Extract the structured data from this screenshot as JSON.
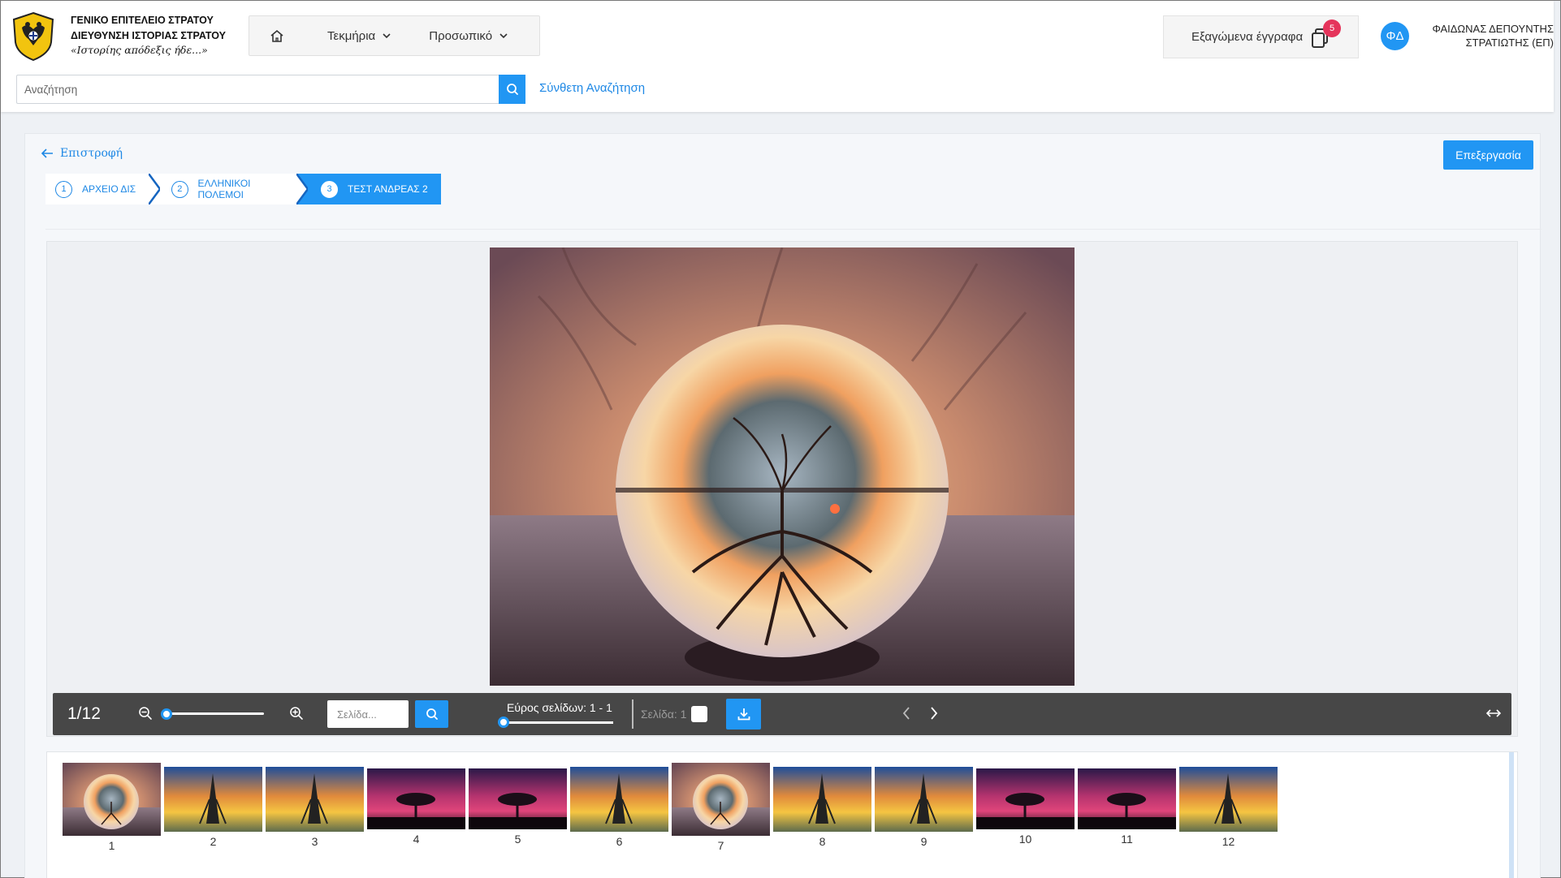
{
  "org": {
    "line1": "ΓΕΝΙΚΟ ΕΠΙΤΕΛΕΙΟ ΣΤΡΑΤΟΥ",
    "line2": "ΔΙΕΥΘΥΝΣΗ ΙΣΤΟΡΙΑΣ ΣΤΡΑΤΟΥ",
    "motto": "«Ιστορίης απόδεξις ήδε...»"
  },
  "nav": {
    "home_icon": "home-icon",
    "items": [
      {
        "label": "Τεκμήρια"
      },
      {
        "label": "Προσωπικό"
      }
    ]
  },
  "exports": {
    "label": "Εξαγώμενα έγγραφα",
    "count": "5"
  },
  "user": {
    "initials": "ΦΔ",
    "name_line1": "ΦΑΙΔΩΝΑΣ ΔΕΠΟΥΝΤΗΣ",
    "name_line2": "ΣΤΡΑΤΙΩΤΗΣ (ΕΠ)"
  },
  "search": {
    "placeholder": "Αναζήτηση",
    "advanced_label": "Σύνθετη Αναζήτηση"
  },
  "page": {
    "back_label": "Επιστροφή",
    "edit_label": "Επεξεργασία"
  },
  "breadcrumbs": [
    {
      "num": "1",
      "label": "ΑΡΧΕΙΟ ΔΙΣ"
    },
    {
      "num": "2",
      "label": "ΕΛΛΗΝΙΚΟΙ ΠΟΛΕΜΟΙ"
    },
    {
      "num": "3",
      "label": "ΤΕΣΤ ΑΝΔΡΕΑΣ 2"
    }
  ],
  "viewer": {
    "page_count": "1/12",
    "page_placeholder": "Σελίδα...",
    "range_label": "Εύρος σελίδων: 1 - 1",
    "page_label": "Σελίδα: 1",
    "zoom_level_fraction": 0.0,
    "colors": {
      "accent": "#2196f3",
      "toolbar": "#474747",
      "badge": "#e5345b"
    }
  },
  "thumbnails": [
    {
      "label": "1",
      "kind": "crystal-ball"
    },
    {
      "label": "2",
      "kind": "eiffel-tower"
    },
    {
      "label": "3",
      "kind": "eiffel-tower"
    },
    {
      "label": "4",
      "kind": "tree-sunset"
    },
    {
      "label": "5",
      "kind": "tree-sunset"
    },
    {
      "label": "6",
      "kind": "eiffel-tower"
    },
    {
      "label": "7",
      "kind": "crystal-ball"
    },
    {
      "label": "8",
      "kind": "eiffel-tower"
    },
    {
      "label": "9",
      "kind": "eiffel-tower"
    },
    {
      "label": "10",
      "kind": "tree-sunset"
    },
    {
      "label": "11",
      "kind": "tree-sunset"
    },
    {
      "label": "12",
      "kind": "eiffel-tower"
    }
  ]
}
